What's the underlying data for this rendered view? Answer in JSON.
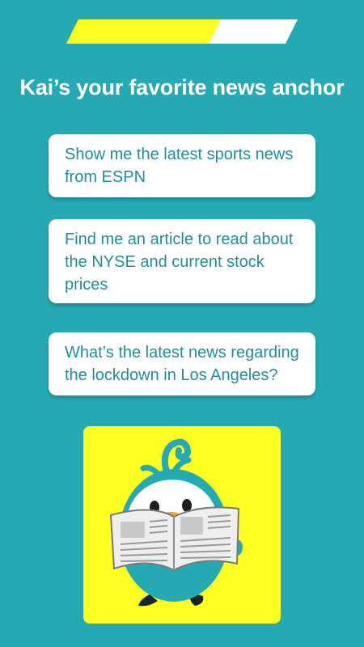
{
  "progress": {
    "fraction": 0.65,
    "fill_color": "#FFFF22",
    "track_color": "#FFFFFF"
  },
  "title": "Kai’s your favorite news anchor",
  "suggestions": [
    {
      "text": "Show me the latest sports news from ESPN"
    },
    {
      "text": "Find me an article to read about the NYSE and current stock prices"
    },
    {
      "text": "What’s the latest news regarding the lockdown in Los Angeles?"
    }
  ],
  "illustration": {
    "icon": "mascot-reading-newspaper-icon",
    "background_color": "#FFFF22"
  },
  "colors": {
    "background": "#25AAB4",
    "card_text": "#1E8F9A"
  }
}
